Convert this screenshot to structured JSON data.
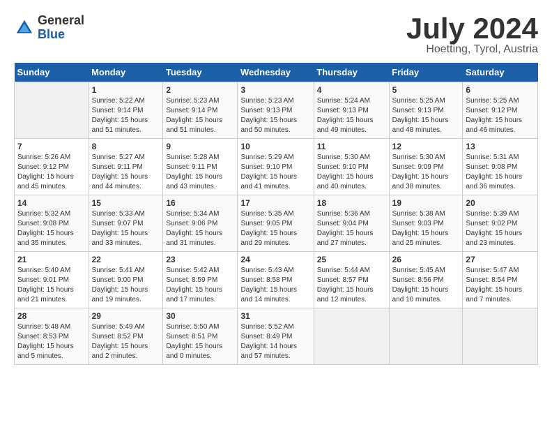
{
  "header": {
    "logo": {
      "general": "General",
      "blue": "Blue"
    },
    "title": "July 2024",
    "subtitle": "Hoetting, Tyrol, Austria"
  },
  "calendar": {
    "headers": [
      "Sunday",
      "Monday",
      "Tuesday",
      "Wednesday",
      "Thursday",
      "Friday",
      "Saturday"
    ],
    "weeks": [
      [
        {
          "day": "",
          "info": ""
        },
        {
          "day": "1",
          "info": "Sunrise: 5:22 AM\nSunset: 9:14 PM\nDaylight: 15 hours\nand 51 minutes."
        },
        {
          "day": "2",
          "info": "Sunrise: 5:23 AM\nSunset: 9:14 PM\nDaylight: 15 hours\nand 51 minutes."
        },
        {
          "day": "3",
          "info": "Sunrise: 5:23 AM\nSunset: 9:13 PM\nDaylight: 15 hours\nand 50 minutes."
        },
        {
          "day": "4",
          "info": "Sunrise: 5:24 AM\nSunset: 9:13 PM\nDaylight: 15 hours\nand 49 minutes."
        },
        {
          "day": "5",
          "info": "Sunrise: 5:25 AM\nSunset: 9:13 PM\nDaylight: 15 hours\nand 48 minutes."
        },
        {
          "day": "6",
          "info": "Sunrise: 5:25 AM\nSunset: 9:12 PM\nDaylight: 15 hours\nand 46 minutes."
        }
      ],
      [
        {
          "day": "7",
          "info": "Sunrise: 5:26 AM\nSunset: 9:12 PM\nDaylight: 15 hours\nand 45 minutes."
        },
        {
          "day": "8",
          "info": "Sunrise: 5:27 AM\nSunset: 9:11 PM\nDaylight: 15 hours\nand 44 minutes."
        },
        {
          "day": "9",
          "info": "Sunrise: 5:28 AM\nSunset: 9:11 PM\nDaylight: 15 hours\nand 43 minutes."
        },
        {
          "day": "10",
          "info": "Sunrise: 5:29 AM\nSunset: 9:10 PM\nDaylight: 15 hours\nand 41 minutes."
        },
        {
          "day": "11",
          "info": "Sunrise: 5:30 AM\nSunset: 9:10 PM\nDaylight: 15 hours\nand 40 minutes."
        },
        {
          "day": "12",
          "info": "Sunrise: 5:30 AM\nSunset: 9:09 PM\nDaylight: 15 hours\nand 38 minutes."
        },
        {
          "day": "13",
          "info": "Sunrise: 5:31 AM\nSunset: 9:08 PM\nDaylight: 15 hours\nand 36 minutes."
        }
      ],
      [
        {
          "day": "14",
          "info": "Sunrise: 5:32 AM\nSunset: 9:08 PM\nDaylight: 15 hours\nand 35 minutes."
        },
        {
          "day": "15",
          "info": "Sunrise: 5:33 AM\nSunset: 9:07 PM\nDaylight: 15 hours\nand 33 minutes."
        },
        {
          "day": "16",
          "info": "Sunrise: 5:34 AM\nSunset: 9:06 PM\nDaylight: 15 hours\nand 31 minutes."
        },
        {
          "day": "17",
          "info": "Sunrise: 5:35 AM\nSunset: 9:05 PM\nDaylight: 15 hours\nand 29 minutes."
        },
        {
          "day": "18",
          "info": "Sunrise: 5:36 AM\nSunset: 9:04 PM\nDaylight: 15 hours\nand 27 minutes."
        },
        {
          "day": "19",
          "info": "Sunrise: 5:38 AM\nSunset: 9:03 PM\nDaylight: 15 hours\nand 25 minutes."
        },
        {
          "day": "20",
          "info": "Sunrise: 5:39 AM\nSunset: 9:02 PM\nDaylight: 15 hours\nand 23 minutes."
        }
      ],
      [
        {
          "day": "21",
          "info": "Sunrise: 5:40 AM\nSunset: 9:01 PM\nDaylight: 15 hours\nand 21 minutes."
        },
        {
          "day": "22",
          "info": "Sunrise: 5:41 AM\nSunset: 9:00 PM\nDaylight: 15 hours\nand 19 minutes."
        },
        {
          "day": "23",
          "info": "Sunrise: 5:42 AM\nSunset: 8:59 PM\nDaylight: 15 hours\nand 17 minutes."
        },
        {
          "day": "24",
          "info": "Sunrise: 5:43 AM\nSunset: 8:58 PM\nDaylight: 15 hours\nand 14 minutes."
        },
        {
          "day": "25",
          "info": "Sunrise: 5:44 AM\nSunset: 8:57 PM\nDaylight: 15 hours\nand 12 minutes."
        },
        {
          "day": "26",
          "info": "Sunrise: 5:45 AM\nSunset: 8:56 PM\nDaylight: 15 hours\nand 10 minutes."
        },
        {
          "day": "27",
          "info": "Sunrise: 5:47 AM\nSunset: 8:54 PM\nDaylight: 15 hours\nand 7 minutes."
        }
      ],
      [
        {
          "day": "28",
          "info": "Sunrise: 5:48 AM\nSunset: 8:53 PM\nDaylight: 15 hours\nand 5 minutes."
        },
        {
          "day": "29",
          "info": "Sunrise: 5:49 AM\nSunset: 8:52 PM\nDaylight: 15 hours\nand 2 minutes."
        },
        {
          "day": "30",
          "info": "Sunrise: 5:50 AM\nSunset: 8:51 PM\nDaylight: 15 hours\nand 0 minutes."
        },
        {
          "day": "31",
          "info": "Sunrise: 5:52 AM\nSunset: 8:49 PM\nDaylight: 14 hours\nand 57 minutes."
        },
        {
          "day": "",
          "info": ""
        },
        {
          "day": "",
          "info": ""
        },
        {
          "day": "",
          "info": ""
        }
      ]
    ]
  }
}
